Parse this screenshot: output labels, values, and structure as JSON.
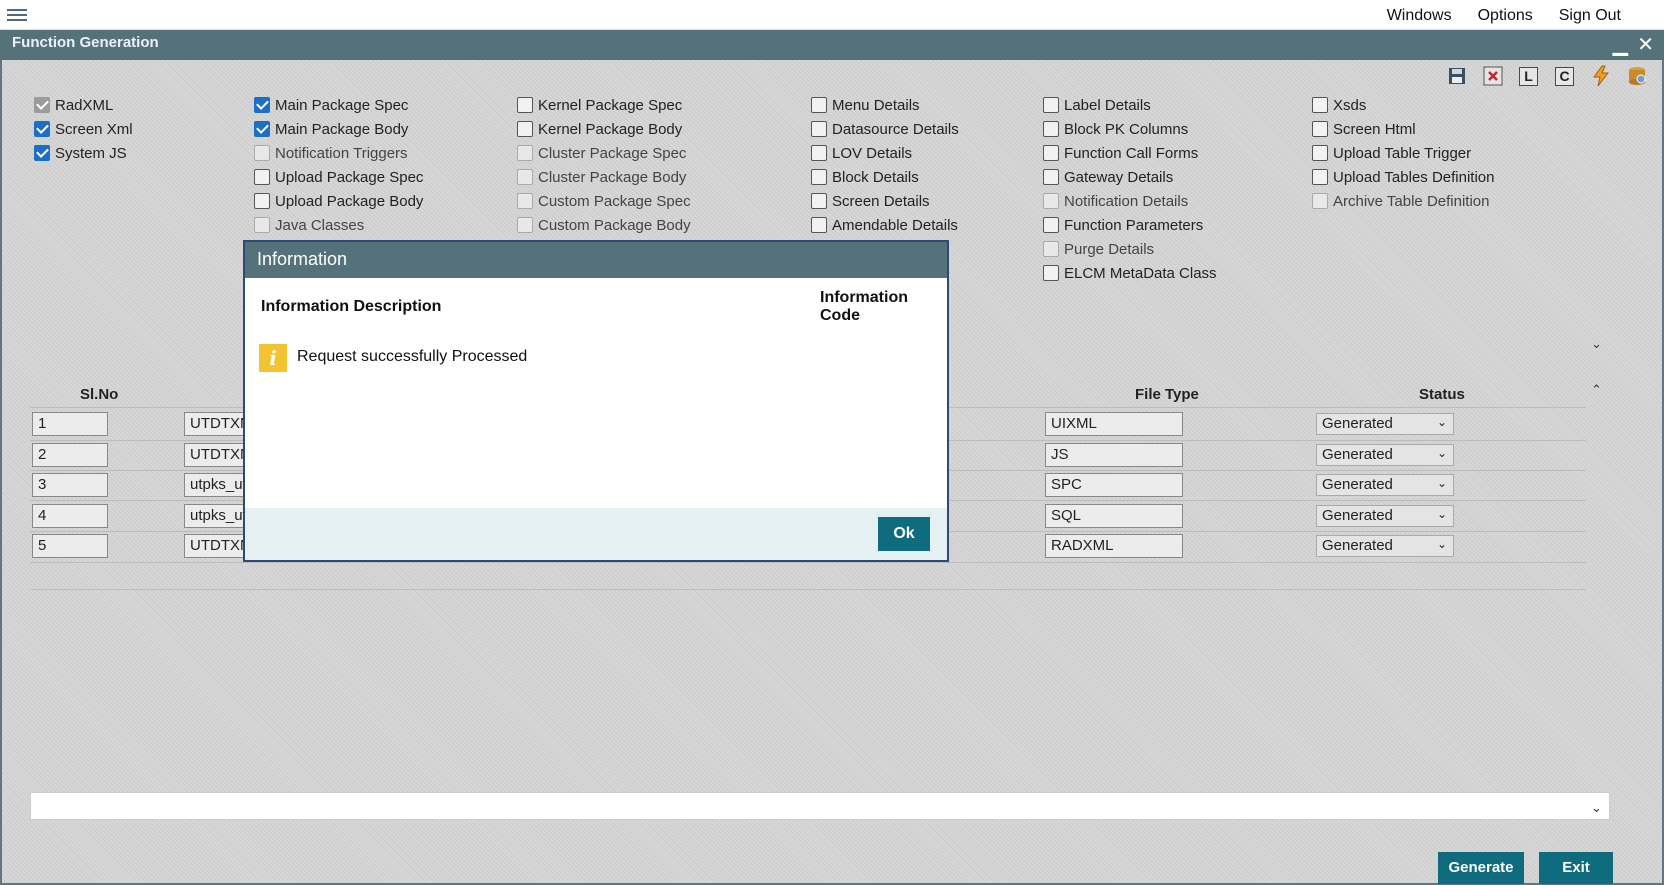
{
  "topbar": {
    "menu": [
      "Windows",
      "Options",
      "Sign Out"
    ]
  },
  "window": {
    "title": "Function Generation",
    "minimize": "▁",
    "close": "✕"
  },
  "toolbar": {
    "l_label": "L",
    "c_label": "C"
  },
  "checkboxes": [
    [
      {
        "label": "RadXML",
        "checked": true,
        "disabled": true
      },
      {
        "label": "Screen Xml",
        "checked": true,
        "disabled": false
      },
      {
        "label": "System JS",
        "checked": true,
        "disabled": false
      }
    ],
    [
      {
        "label": "Main Package Spec",
        "checked": true,
        "disabled": false
      },
      {
        "label": "Main Package Body",
        "checked": true,
        "disabled": false
      },
      {
        "label": "Notification Triggers",
        "checked": false,
        "disabled": true
      },
      {
        "label": "Upload Package Spec",
        "checked": false,
        "disabled": false
      },
      {
        "label": "Upload Package Body",
        "checked": false,
        "disabled": false
      },
      {
        "label": "Java Classes",
        "checked": false,
        "disabled": true
      }
    ],
    [
      {
        "label": "Kernel Package Spec",
        "checked": false,
        "disabled": false
      },
      {
        "label": "Kernel Package Body",
        "checked": false,
        "disabled": false
      },
      {
        "label": "Cluster Package Spec",
        "checked": false,
        "disabled": true
      },
      {
        "label": "Cluster Package Body",
        "checked": false,
        "disabled": true
      },
      {
        "label": "Custom Package Spec",
        "checked": false,
        "disabled": true
      },
      {
        "label": "Custom Package Body",
        "checked": false,
        "disabled": true
      }
    ],
    [
      {
        "label": "Menu Details",
        "checked": false,
        "disabled": false
      },
      {
        "label": "Datasource Details",
        "checked": false,
        "disabled": false
      },
      {
        "label": "LOV Details",
        "checked": false,
        "disabled": false
      },
      {
        "label": "Block Details",
        "checked": false,
        "disabled": false
      },
      {
        "label": "Screen Details",
        "checked": false,
        "disabled": false
      },
      {
        "label": "Amendable Details",
        "checked": false,
        "disabled": false
      }
    ],
    [
      {
        "label": "Label Details",
        "checked": false,
        "disabled": false
      },
      {
        "label": "Block PK Columns",
        "checked": false,
        "disabled": false
      },
      {
        "label": "Function Call Forms",
        "checked": false,
        "disabled": false
      },
      {
        "label": "Gateway Details",
        "checked": false,
        "disabled": false
      },
      {
        "label": "Notification Details",
        "checked": false,
        "disabled": true
      },
      {
        "label": "Function Parameters",
        "checked": false,
        "disabled": false
      },
      {
        "label": "Purge Details",
        "checked": false,
        "disabled": true
      },
      {
        "label": "ELCM MetaData Class",
        "checked": false,
        "disabled": false
      }
    ],
    [
      {
        "label": "Xsds",
        "checked": false,
        "disabled": false
      },
      {
        "label": "Screen Html",
        "checked": false,
        "disabled": false
      },
      {
        "label": "Upload Table Trigger",
        "checked": false,
        "disabled": false
      },
      {
        "label": "Upload Tables Definition",
        "checked": false,
        "disabled": false
      },
      {
        "label": "Archive Table Definition",
        "checked": false,
        "disabled": true
      }
    ]
  ],
  "grid": {
    "headers": {
      "slno": "Sl.No",
      "filetype": "File Type",
      "status": "Status"
    },
    "rows": [
      {
        "slno": "1",
        "name": "UTDTXN",
        "filetype": "UIXML",
        "status": "Generated"
      },
      {
        "slno": "2",
        "name": "UTDTXN",
        "filetype": "JS",
        "status": "Generated"
      },
      {
        "slno": "3",
        "name": "utpks_ut",
        "filetype": "SPC",
        "status": "Generated"
      },
      {
        "slno": "4",
        "name": "utpks_ut",
        "filetype": "SQL",
        "status": "Generated"
      },
      {
        "slno": "5",
        "name": "UTDTXN",
        "filetype": "RADXML",
        "status": "Generated"
      }
    ]
  },
  "buttons": {
    "generate": "Generate",
    "exit": "Exit"
  },
  "dialog": {
    "title": "Information",
    "col_description": "Information Description",
    "col_code": "Information Code",
    "message": "Request successfully Processed",
    "icon": "i",
    "ok": "Ok"
  }
}
